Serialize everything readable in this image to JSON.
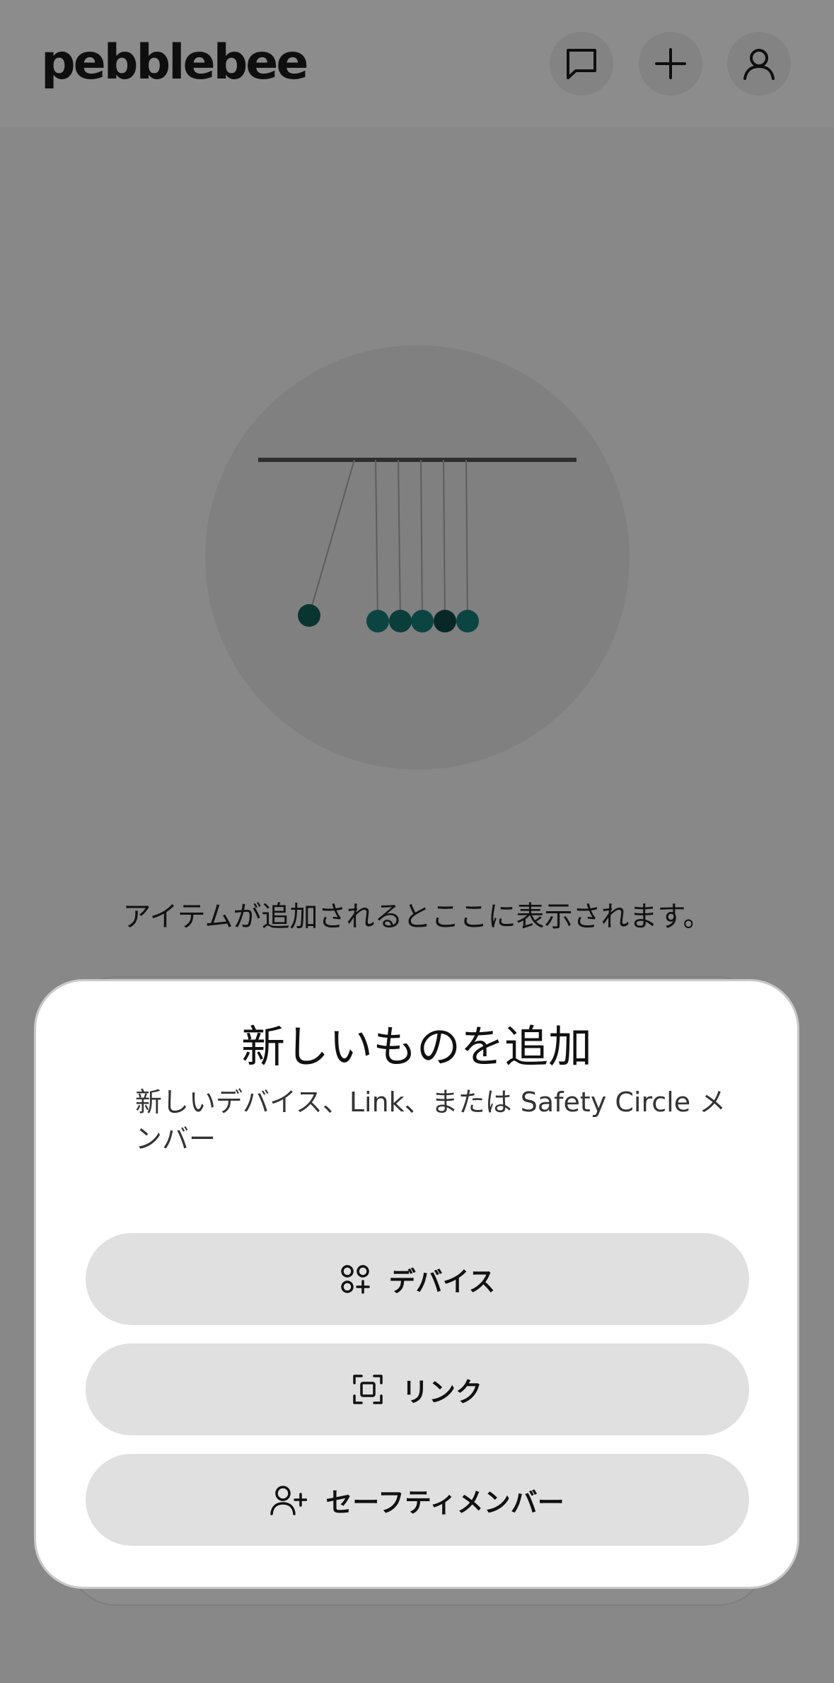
{
  "header": {
    "logo_text": "pebblebee",
    "icons": {
      "chat": "chat-bubble-icon",
      "add": "plus-icon",
      "profile": "user-icon"
    }
  },
  "main": {
    "illustration_icon": "newtons-cradle-illustration",
    "empty_message": "アイテムが追加されるとここに表示されます。"
  },
  "sheet": {
    "title": "新しいものを追加",
    "subtitle": "新しいデバイス、Link、または Safety Circle メンバー",
    "options": [
      {
        "label": "デバイス",
        "icon": "device-grid-add-icon"
      },
      {
        "label": "リンク",
        "icon": "scan-frame-icon"
      },
      {
        "label": "セーフティメンバー",
        "icon": "user-add-icon"
      }
    ]
  },
  "colors": {
    "background": "#f7f7f7",
    "accent_teal": "#0f5f59",
    "button_gray": "#e0e0e0"
  }
}
